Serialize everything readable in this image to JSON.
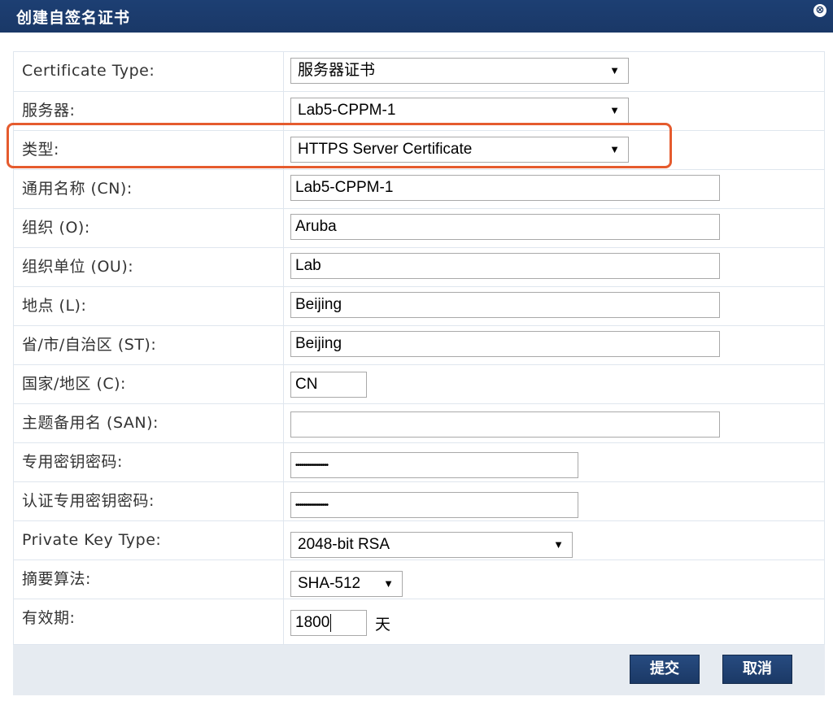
{
  "dialog": {
    "title": "创建自签名证书",
    "close_icon": "⊗"
  },
  "form": {
    "certificate_type": {
      "label": "Certificate Type:",
      "value": "服务器证书"
    },
    "server": {
      "label": "服务器:",
      "value": "Lab5-CPPM-1"
    },
    "type": {
      "label": "类型:",
      "value": "HTTPS Server Certificate"
    },
    "common_name": {
      "label": "通用名称 (CN):",
      "value": "Lab5-CPPM-1"
    },
    "organization": {
      "label": "组织 (O):",
      "value": "Aruba"
    },
    "org_unit": {
      "label": "组织单位 (OU):",
      "value": "Lab"
    },
    "locality": {
      "label": "地点 (L):",
      "value": "Beijing"
    },
    "state": {
      "label": "省/市/自治区 (ST):",
      "value": "Beijing"
    },
    "country": {
      "label": "国家/地区 (C):",
      "value": "CN"
    },
    "san": {
      "label": "主题备用名 (SAN):",
      "value": ""
    },
    "private_key_password": {
      "label": "专用密钥密码:",
      "value": "••••••••••••••••"
    },
    "verify_private_key_password": {
      "label": "认证专用密钥密码:",
      "value": "••••••••••••••••"
    },
    "private_key_type": {
      "label": "Private Key Type:",
      "value": "2048-bit RSA"
    },
    "digest_algorithm": {
      "label": "摘要算法:",
      "value": "SHA-512"
    },
    "validity": {
      "label": "有效期:",
      "value": "1800",
      "unit": "天"
    }
  },
  "buttons": {
    "submit": "提交",
    "cancel": "取消"
  },
  "colors": {
    "titlebar": "#1a3867",
    "highlight": "#e55b2e",
    "grid": "#dfe6ee",
    "footer": "#e6ebf1"
  }
}
